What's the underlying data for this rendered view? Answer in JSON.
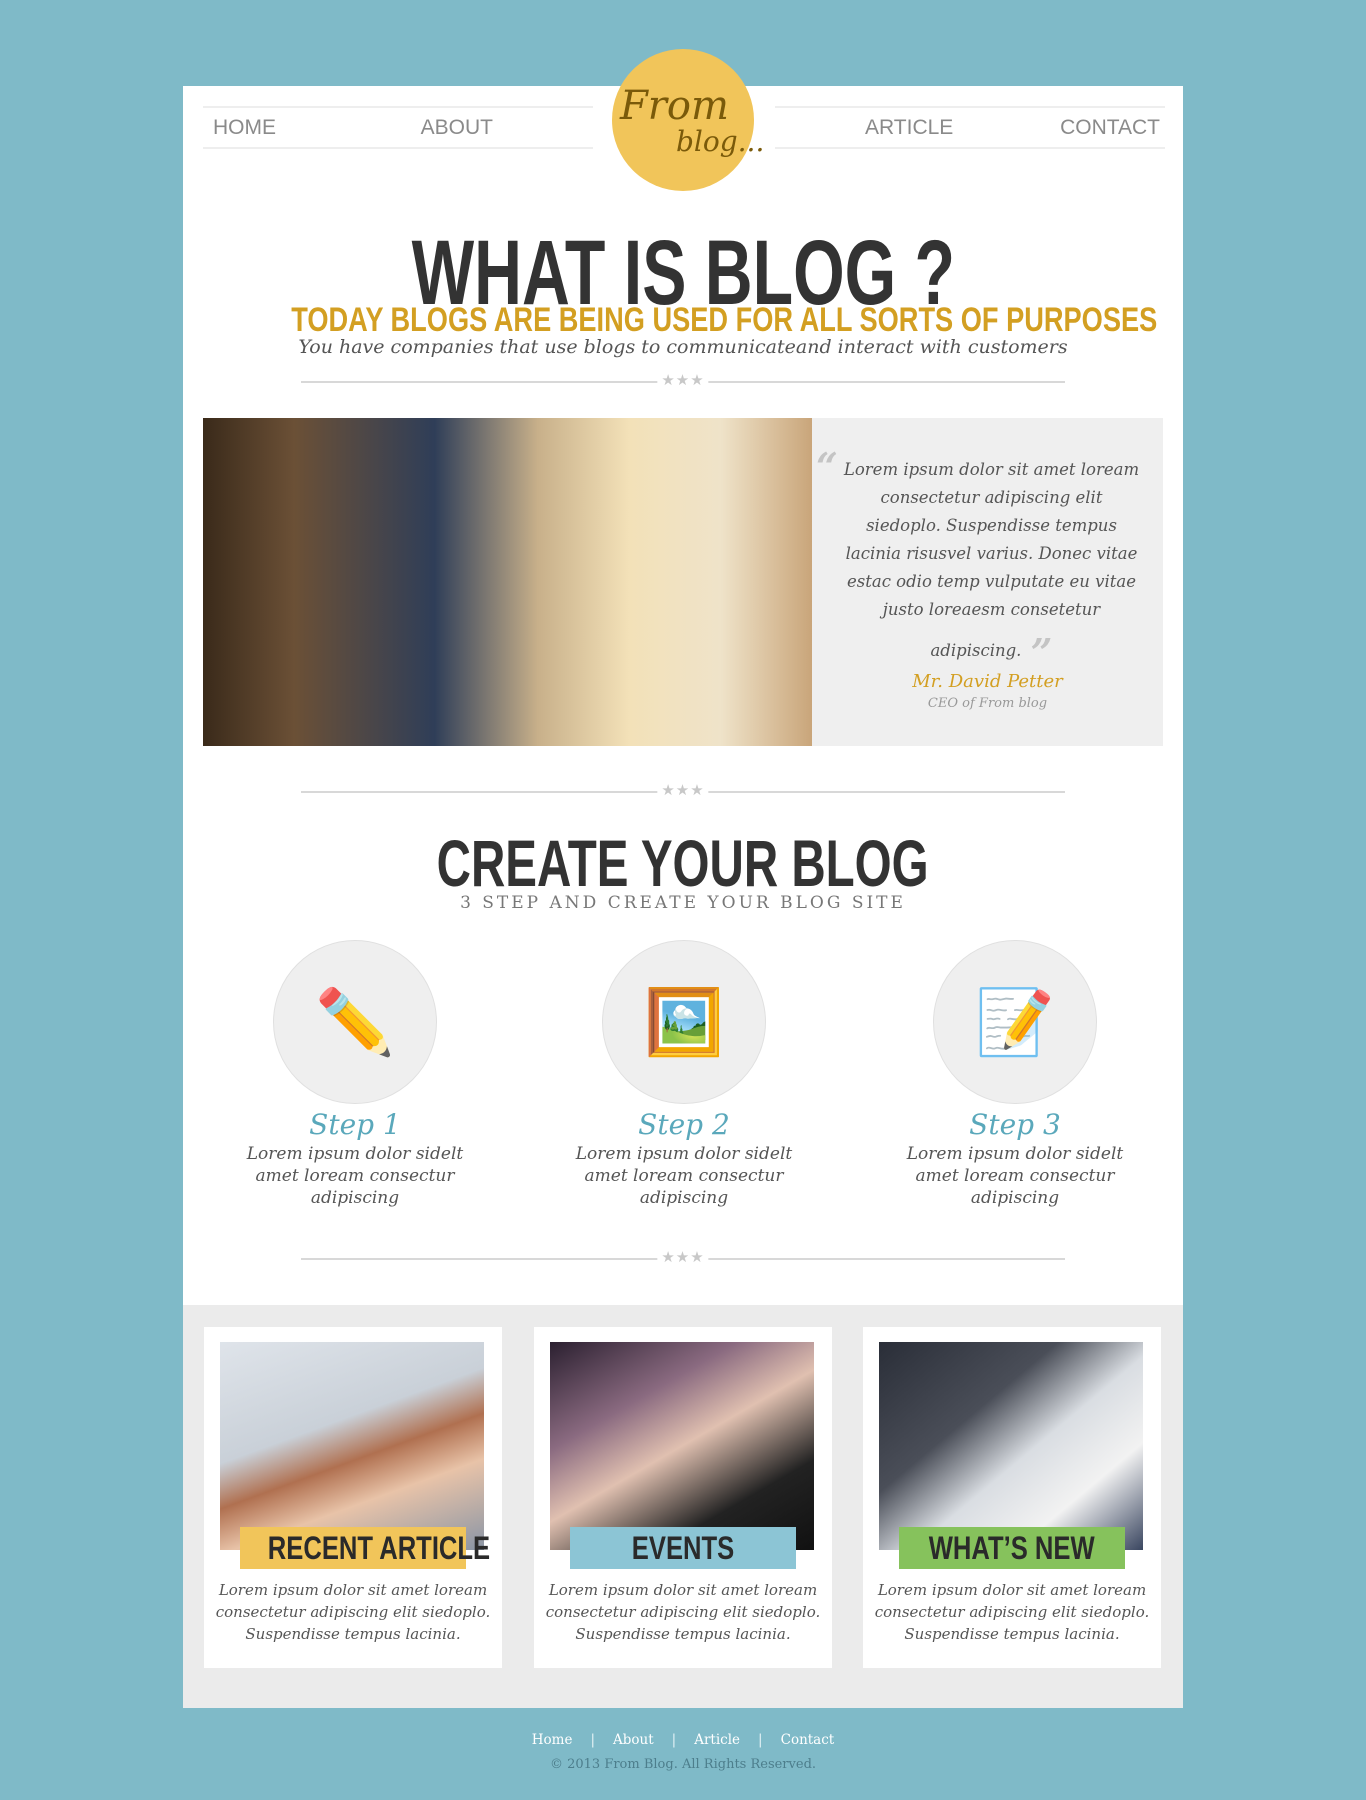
{
  "nav": {
    "left": [
      "HOME",
      "ABOUT"
    ],
    "right": [
      "ARTICLE",
      "CONTACT"
    ]
  },
  "logo": {
    "line1": "From",
    "line2": "blog..."
  },
  "hero": {
    "title": "WHAT IS BLOG ?",
    "subtitle": "TODAY BLOGS ARE BEING USED FOR ALL SORTS OF PURPOSES",
    "intro": "You have companies that use blogs to communicateand interact with customers"
  },
  "divider_stars": "★★★",
  "quote": {
    "text": "Lorem ipsum dolor sit amet loream consectetur adipiscing elit siedoplo. Suspendisse tempus lacinia risusvel varius. Donec vitae estac odio temp vulputate eu vitae justo loreaesm consetetur adipiscing.",
    "open": "“",
    "close": "”",
    "name": "Mr. David Petter",
    "role": "CEO of From blog"
  },
  "create": {
    "title": "CREATE YOUR BLOG",
    "subtitle": "3 STEP AND CREATE YOUR BLOG SITE"
  },
  "steps": [
    {
      "label": "Step 1",
      "text": "Lorem ipsum dolor sidelt amet loream consectur adipiscing",
      "icon": "✏️"
    },
    {
      "label": "Step 2",
      "text": "Lorem ipsum dolor sidelt amet loream consectur adipiscing",
      "icon": "🖼️"
    },
    {
      "label": "Step 3",
      "text": "Lorem ipsum dolor sidelt amet loream consectur adipiscing",
      "icon": "📝"
    }
  ],
  "cards": [
    {
      "label": "RECENT ARTICLE",
      "text": "Lorem ipsum dolor sit amet loream consectetur adipiscing elit siedoplo. Suspendisse tempus lacinia.",
      "color": "#f1c55a"
    },
    {
      "label": "EVENTS",
      "text": "Lorem ipsum dolor sit amet loream consectetur adipiscing elit siedoplo. Suspendisse tempus lacinia.",
      "color": "#8cc5d5"
    },
    {
      "label": "WHAT’S NEW",
      "text": "Lorem ipsum dolor sit amet loream consectetur adipiscing elit siedoplo. Suspendisse tempus lacinia.",
      "color": "#86c25c"
    }
  ],
  "footer": {
    "links": [
      "Home",
      "About",
      "Article",
      "Contact"
    ],
    "separator": "|",
    "copyright": "© 2013 From Blog. All Rights Reserved."
  }
}
